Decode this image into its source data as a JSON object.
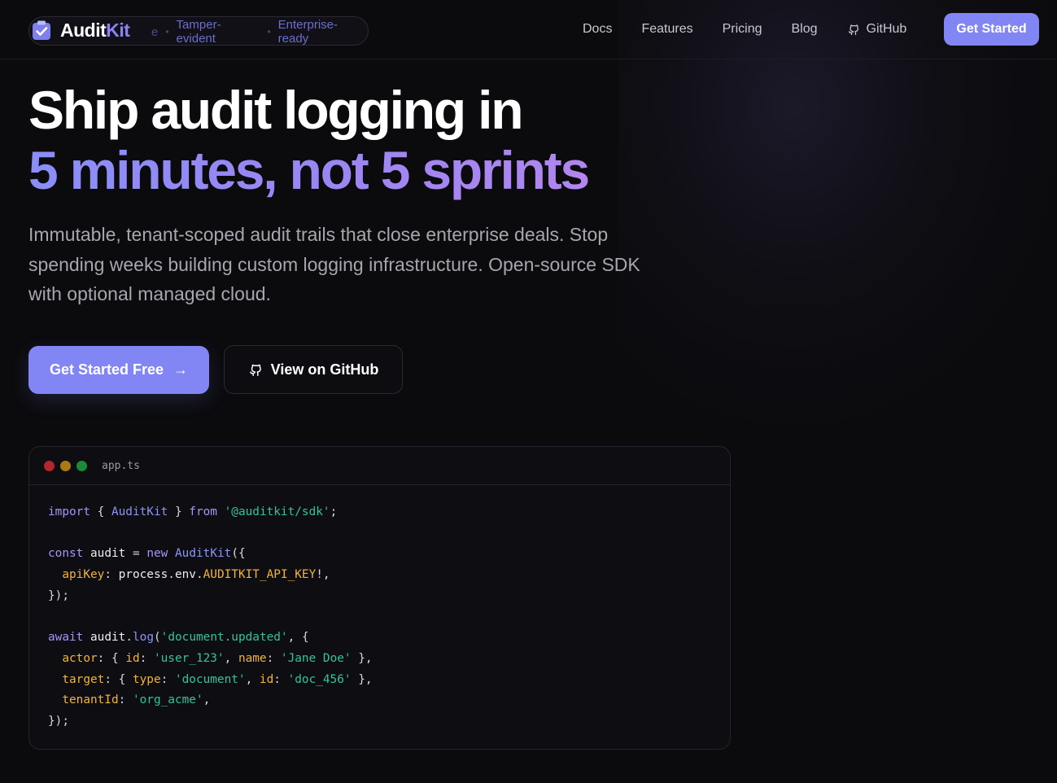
{
  "nav": {
    "logo_text_main": "Audit",
    "logo_text_accent": "Kit",
    "tags": [
      "Tamper-evident",
      "Enterprise-ready"
    ],
    "hidden_tag": "e",
    "links": [
      "Docs",
      "Features",
      "Pricing",
      "Blog",
      "GitHub"
    ],
    "cta": "Get Started"
  },
  "hero": {
    "title_line1": "Ship audit logging in",
    "title_line2": "5 minutes, not 5 sprints",
    "subtitle": "Immutable, tenant-scoped audit trails that close enterprise deals. Stop spending weeks building custom logging infrastructure. Open-source SDK with optional managed cloud.",
    "primary_button": "Get Started Free",
    "primary_arrow": "→",
    "secondary_button": "View on GitHub"
  },
  "code_window": {
    "filename": "app.ts",
    "lines": [
      [
        [
          "kw",
          "import"
        ],
        [
          "pl",
          " { "
        ],
        [
          "fn",
          "AuditKit"
        ],
        [
          "pl",
          " } "
        ],
        [
          "kw",
          "from"
        ],
        [
          "pl",
          " "
        ],
        [
          "str",
          "'@auditkit/sdk'"
        ],
        [
          "pl",
          ";"
        ]
      ],
      [],
      [
        [
          "kw",
          "const"
        ],
        [
          "pl",
          " "
        ],
        [
          "id",
          "audit"
        ],
        [
          "pl",
          " = "
        ],
        [
          "kw",
          "new"
        ],
        [
          "pl",
          " "
        ],
        [
          "fn",
          "AuditKit"
        ],
        [
          "pl",
          "({"
        ]
      ],
      [
        [
          "pl",
          "  "
        ],
        [
          "prop",
          "apiKey"
        ],
        [
          "pl",
          ": "
        ],
        [
          "id",
          "process"
        ],
        [
          "pl",
          "."
        ],
        [
          "id",
          "env"
        ],
        [
          "pl",
          "."
        ],
        [
          "prop",
          "AUDITKIT_API_KEY"
        ],
        [
          "pl",
          "!,"
        ]
      ],
      [
        [
          "pl",
          "});"
        ]
      ],
      [],
      [
        [
          "kw",
          "await"
        ],
        [
          "pl",
          " "
        ],
        [
          "id",
          "audit"
        ],
        [
          "pl",
          "."
        ],
        [
          "fn",
          "log"
        ],
        [
          "pl",
          "("
        ],
        [
          "str",
          "'document.updated'"
        ],
        [
          "pl",
          ", {"
        ]
      ],
      [
        [
          "pl",
          "  "
        ],
        [
          "prop",
          "actor"
        ],
        [
          "pl",
          ": { "
        ],
        [
          "prop",
          "id"
        ],
        [
          "pl",
          ": "
        ],
        [
          "str",
          "'user_123'"
        ],
        [
          "pl",
          ", "
        ],
        [
          "prop",
          "name"
        ],
        [
          "pl",
          ": "
        ],
        [
          "str",
          "'Jane Doe'"
        ],
        [
          "pl",
          " },"
        ]
      ],
      [
        [
          "pl",
          "  "
        ],
        [
          "prop",
          "target"
        ],
        [
          "pl",
          ": { "
        ],
        [
          "prop",
          "type"
        ],
        [
          "pl",
          ": "
        ],
        [
          "str",
          "'document'"
        ],
        [
          "pl",
          ", "
        ],
        [
          "prop",
          "id"
        ],
        [
          "pl",
          ": "
        ],
        [
          "str",
          "'doc_456'"
        ],
        [
          "pl",
          " },"
        ]
      ],
      [
        [
          "pl",
          "  "
        ],
        [
          "prop",
          "tenantId"
        ],
        [
          "pl",
          ": "
        ],
        [
          "str",
          "'org_acme'"
        ],
        [
          "pl",
          ","
        ]
      ],
      [
        [
          "pl",
          "});"
        ]
      ]
    ]
  },
  "colors": {
    "accent": "#8186f4",
    "background": "#0b0b0e",
    "keyword": "#a594f9",
    "string": "#34c39a",
    "property": "#f0b43c"
  },
  "icons": {
    "logo": "clipboard-check-icon",
    "github": "github-icon",
    "arrow": "arrow-right-icon"
  }
}
